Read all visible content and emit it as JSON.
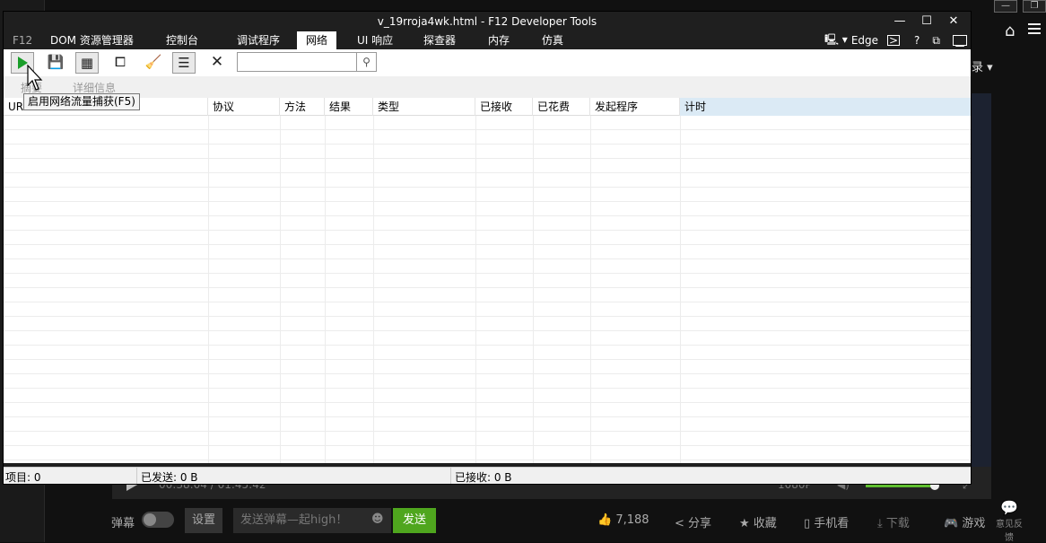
{
  "background": {
    "login_text": "录",
    "home_icon": "home-icon",
    "video_time": "00:38:04 / 01:45:42",
    "quality": "1080P",
    "danmu_label": "弹幕",
    "settings_label": "设置",
    "danmu_placeholder": "发送弹幕—起high！",
    "send_label": "发送",
    "like_count": "7,188",
    "share_label": "分享",
    "fav_label": "收藏",
    "mobile_label": "手机看",
    "download_label": "下载",
    "game_label": "游戏",
    "feedback_label": "意见反馈",
    "accent_color": "#4fa61e"
  },
  "window": {
    "title": "v_19rroja4wk.html - F12 Developer Tools",
    "minimize": "—",
    "maximize": "☐",
    "close": "✕"
  },
  "tabs": [
    {
      "label": "F12"
    },
    {
      "label": "DOM 资源管理器"
    },
    {
      "label": "控制台"
    },
    {
      "label": "调试程序"
    },
    {
      "label": "网络"
    },
    {
      "label": "UI 响应"
    },
    {
      "label": "探查器"
    },
    {
      "label": "内存"
    },
    {
      "label": "仿真"
    }
  ],
  "active_tab": "网络",
  "emulation": {
    "browser_label": "Edge",
    "help": "?"
  },
  "toolbar": {
    "search_value": "",
    "tooltip": "启用网络流量捕获(F5)"
  },
  "subtabs": {
    "summary": "摘要",
    "details": "详细信息"
  },
  "columns": [
    {
      "label": "URL"
    },
    {
      "label": "协议"
    },
    {
      "label": "方法"
    },
    {
      "label": "结果"
    },
    {
      "label": "类型"
    },
    {
      "label": "已接收"
    },
    {
      "label": "已花费"
    },
    {
      "label": "发起程序"
    },
    {
      "label": "计时"
    }
  ],
  "status": {
    "items": "项目: 0",
    "sent": "已发送: 0 B",
    "received": "已接收: 0 B"
  }
}
